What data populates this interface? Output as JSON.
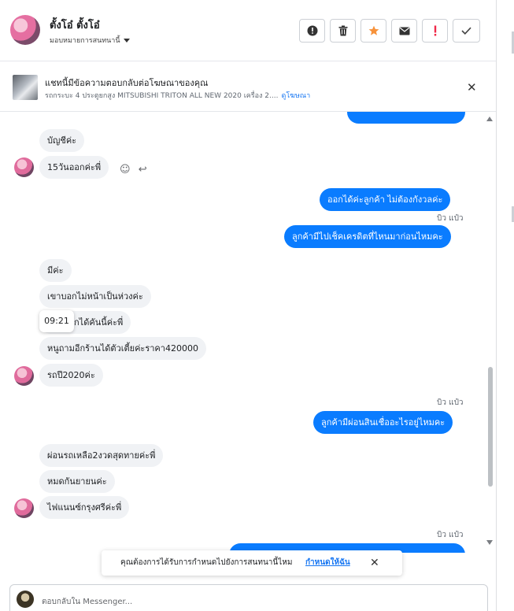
{
  "header": {
    "name": "ตั้งโอ๋ ตั้งโอ๋",
    "assign_label": "มอบหมายการสนทนานี้",
    "actions": [
      "alert-circle-icon",
      "trash-icon",
      "star-icon",
      "mail-icon",
      "exclamation-icon",
      "check-icon"
    ],
    "colors": {
      "star": "#f7923a",
      "exclamation": "#f02849"
    }
  },
  "ad": {
    "title": "แชทนี้มีข้อความตอบกลับต่อโฆษณาของคุณ",
    "subtitle": "รถกระบะ 4 ประตูยกสูง MITSUBISHI TRITON ALL NEW 2020 เครื่อง 2....",
    "link": "ดูโฆษณา"
  },
  "messages": [
    {
      "text": "บัญชีค่ะ"
    },
    {
      "text": "15วันออกค่ะพี่"
    },
    {
      "text": "ออกได้ค่ะลูกค้า  ไม่ต้องกังวลค่ะ"
    },
    {
      "text": "ลูกค้ามีไปเช็คเครดิตที่ไหนมาก่อนไหมคะ"
    },
    {
      "text": "มีค่ะ"
    },
    {
      "text": "เขาบอกไม่หน้าเป็นห่วงค่ะ"
    },
    {
      "text": "กได้คันนี้ค่ะพี่"
    },
    {
      "text": "หนูถามอีกร้านได้ตัวเตี้ยค่ะราคา420000"
    },
    {
      "text": "รถปี2020ค่ะ"
    },
    {
      "text": "ลูกค้ามีผ่อนสินเชื่ออะไรอยู่ไหมคะ"
    },
    {
      "text": "ผ่อนรถเหลือ2งวดสุดทายค่ะพี่"
    },
    {
      "text": "หมดกันยายนค่ะ"
    },
    {
      "text": "ไฟแนนซ์กรุงศรีค่ะพี่"
    }
  ],
  "seen_labels": [
    "บิว แป๋ว",
    "บิว แป๋ว",
    "บิว แป๋ว"
  ],
  "tooltip_time": "09:21",
  "toast": {
    "text": "คุณต้องการได้รับการกำหนดไปยังการสนทนานี้ไหม",
    "link": "กำหนดให้ฉัน"
  },
  "composer": {
    "placeholder": "ตอบกลับใน Messenger..."
  },
  "colors": {
    "outgoing_bubble": "#0a7cff",
    "incoming_bubble": "#f0f2f5",
    "link": "#1877f2"
  }
}
